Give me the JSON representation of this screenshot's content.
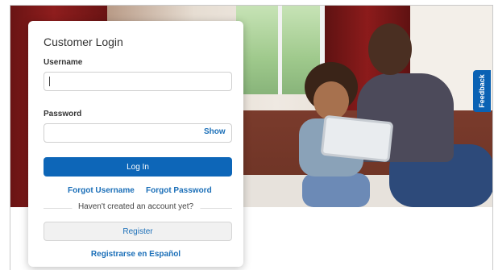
{
  "login": {
    "title": "Customer Login",
    "username_label": "Username",
    "username_value": "",
    "password_label": "Password",
    "password_value": "",
    "show_label": "Show",
    "login_button": "Log In",
    "forgot_username": "Forgot Username",
    "forgot_password": "Forgot Password",
    "no_account_text": "Haven't created an account yet?",
    "register_button": "Register",
    "spanish_link": "Registrarse en Español"
  },
  "feedback": {
    "label": "Feedback"
  },
  "colors": {
    "primary": "#0d66b8",
    "link": "#1b6fb8",
    "feedback": "#0a62b4"
  }
}
